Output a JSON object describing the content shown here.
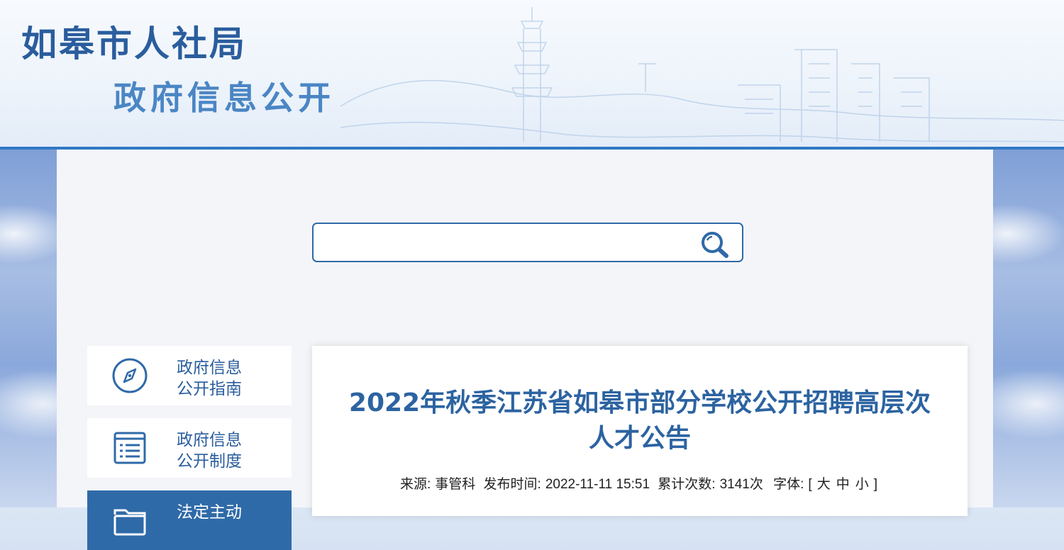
{
  "header": {
    "title": "如皋市人社局",
    "subtitle": "政府信息公开"
  },
  "search": {
    "value": "",
    "placeholder": ""
  },
  "sidebar": {
    "items": [
      {
        "line1": "政府信息",
        "line2": "公开指南",
        "icon": "compass-icon"
      },
      {
        "line1": "政府信息",
        "line2": "公开制度",
        "icon": "document-list-icon"
      },
      {
        "line1": "法定主动",
        "line2": "",
        "icon": "folder-icon"
      }
    ]
  },
  "article": {
    "title": "2022年秋季江苏省如皋市部分学校公开招聘高层次人才公告",
    "source_label": "来源:",
    "source": "事管科",
    "published_label": "发布时间:",
    "published": "2022-11-11 15:51",
    "views_label": "累计次数:",
    "views": "3141次",
    "font_label": "字体:",
    "bracket_open": "[",
    "font_large": "大",
    "font_medium": "中",
    "font_small": "小",
    "bracket_close": "]"
  },
  "colors": {
    "primary": "#2f6aa8",
    "title_blue": "#2c63a1",
    "header_line": "#2f78c4"
  }
}
